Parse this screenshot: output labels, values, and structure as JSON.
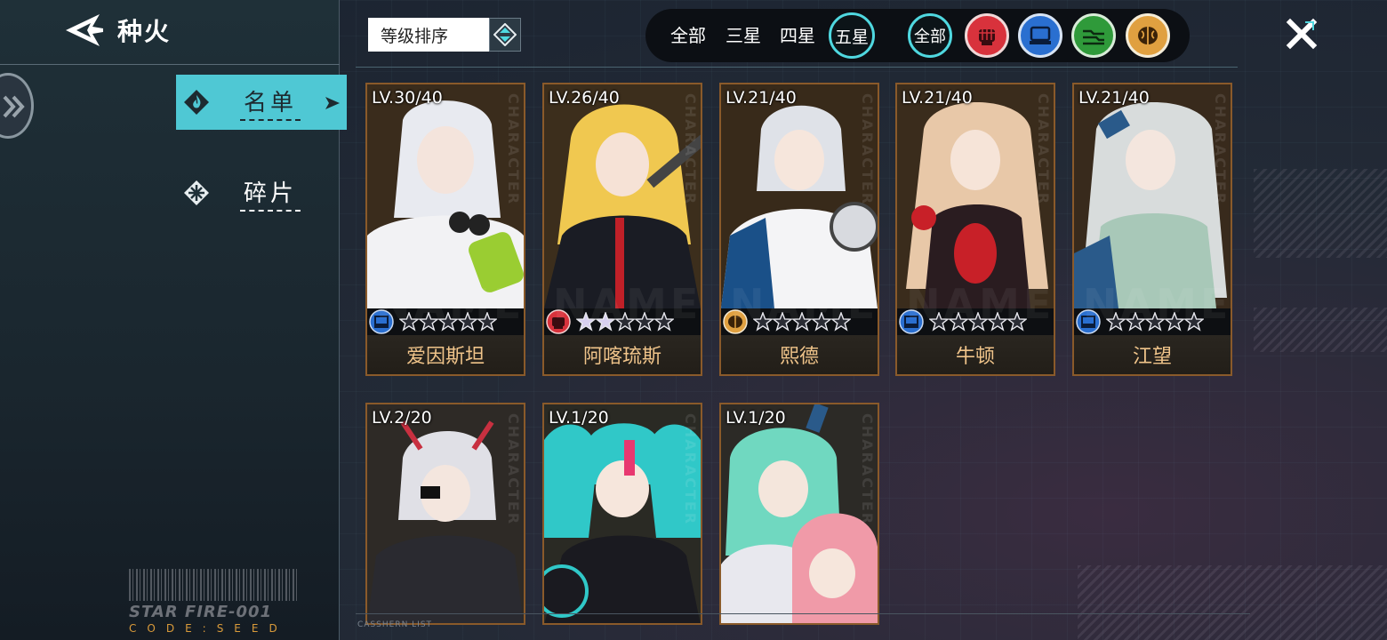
{
  "header": {
    "title": "种火"
  },
  "sidebar": {
    "tabs": [
      {
        "label": "名单",
        "active": true
      },
      {
        "label": "碎片",
        "active": false
      }
    ],
    "brand": "STAR FIRE-001",
    "code": "CODE:SEED"
  },
  "sort": {
    "label": "等级排序"
  },
  "filters": {
    "stars": [
      "全部",
      "三星",
      "四星",
      "五星"
    ],
    "selected_star": "五星",
    "types": [
      {
        "label": "全部",
        "icon": "all"
      },
      {
        "label": "",
        "icon": "fist-icon",
        "color": "#d8323c"
      },
      {
        "label": "",
        "icon": "computer-icon",
        "color": "#2a6fd0"
      },
      {
        "label": "",
        "icon": "circuit-icon",
        "color": "#2f9a3a"
      },
      {
        "label": "",
        "icon": "brain-icon",
        "color": "#e0a040"
      }
    ]
  },
  "cards": [
    {
      "level": "LV.30/40",
      "name": "爱因斯坦",
      "type": "computer",
      "stars_filled": 0,
      "palette": [
        "#e8eaf0",
        "#b8c0c8",
        "#9acd32"
      ]
    },
    {
      "level": "LV.26/40",
      "name": "阿喀琉斯",
      "type": "fist",
      "stars_filled": 2,
      "palette": [
        "#f0c850",
        "#1a1c24",
        "#c02028"
      ]
    },
    {
      "level": "LV.21/40",
      "name": "熙德",
      "type": "brain",
      "stars_filled": 0,
      "palette": [
        "#dfe2e8",
        "#ffffff",
        "#1a5088"
      ]
    },
    {
      "level": "LV.21/40",
      "name": "牛顿",
      "type": "computer",
      "stars_filled": 0,
      "palette": [
        "#e8c8a8",
        "#2a1c20",
        "#c82028"
      ]
    },
    {
      "level": "LV.21/40",
      "name": "江望",
      "type": "computer",
      "stars_filled": 0,
      "palette": [
        "#d8dcdc",
        "#a8c8b8",
        "#2a5a8a"
      ]
    },
    {
      "level": "LV.2/20",
      "name": "",
      "type": "",
      "stars_filled": 0,
      "palette": [
        "#e0e0e6",
        "#2a2a30",
        "#c83040"
      ]
    },
    {
      "level": "LV.1/20",
      "name": "",
      "type": "",
      "stars_filled": 0,
      "palette": [
        "#30c8c8",
        "#1a1a20",
        "#e83870"
      ]
    },
    {
      "level": "LV.1/20",
      "name": "",
      "type": "",
      "stars_filled": 0,
      "palette": [
        "#70d8c0",
        "#f09aa8",
        "#e8e8ee"
      ]
    }
  ],
  "card_side_text": "CHARACTER",
  "card_bg_word": "NAME",
  "footer": {
    "caption": "CASSHERN LIST"
  }
}
